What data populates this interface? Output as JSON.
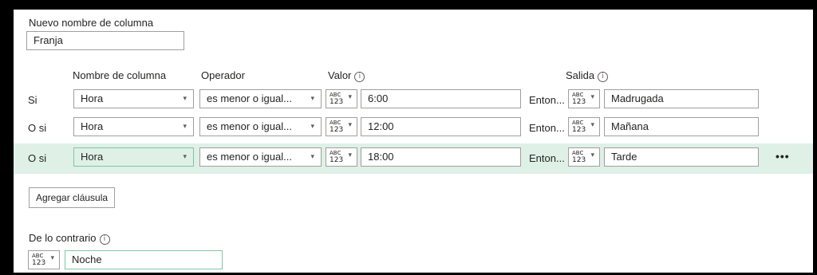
{
  "new_column": {
    "label": "Nuevo nombre de columna",
    "value": "Franja"
  },
  "headers": {
    "column_name": "Nombre de columna",
    "operator": "Operador",
    "value": "Valor",
    "output": "Salida",
    "info_glyph": "i"
  },
  "type_badge": {
    "line1": "ABC",
    "line2": "123"
  },
  "then_label": "Enton...",
  "rows": [
    {
      "prefix": "Si",
      "column": "Hora",
      "operator": "es menor o igual...",
      "value": "6:00",
      "output": "Madrugada"
    },
    {
      "prefix": "O si",
      "column": "Hora",
      "operator": "es menor o igual...",
      "value": "12:00",
      "output": "Mañana"
    },
    {
      "prefix": "O si",
      "column": "Hora",
      "operator": "es menor o igual...",
      "value": "18:00",
      "output": "Tarde"
    }
  ],
  "more_glyph": "•••",
  "add_clause_label": "Agregar cláusula",
  "else": {
    "label": "De lo contrario",
    "value": "Noche"
  }
}
